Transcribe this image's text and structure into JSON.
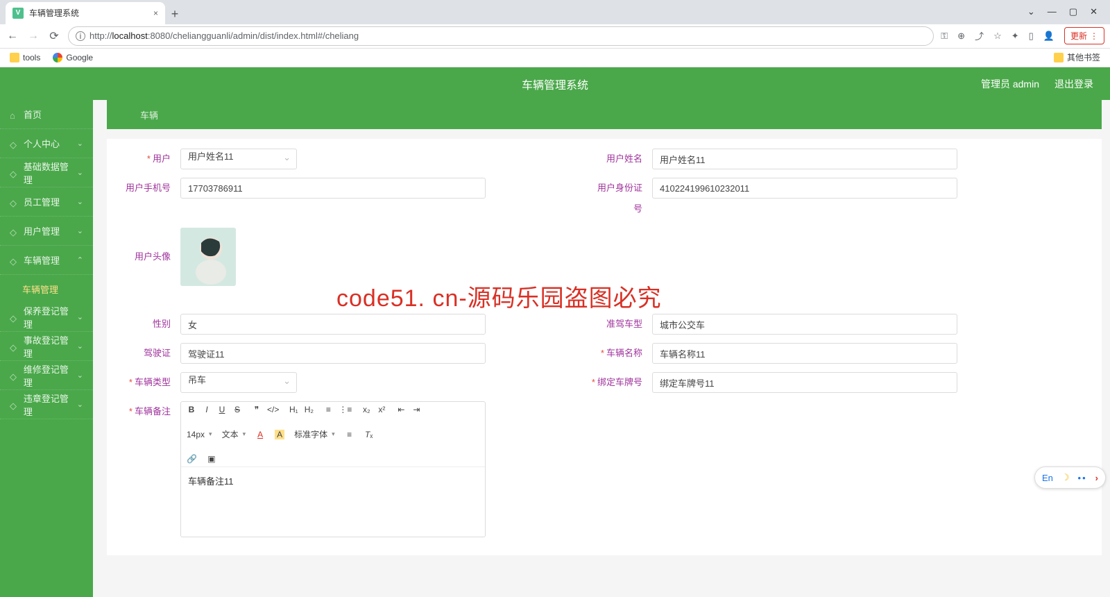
{
  "browser": {
    "tab_title": "车辆管理系统",
    "url_host": "localhost",
    "url_port": ":8080",
    "url_path": "/cheliangguanli/admin/dist/index.html#/cheliang",
    "url_prefix": "http://",
    "update_label": "更新",
    "bookmarks": {
      "tools": "tools",
      "google": "Google",
      "other": "其他书签"
    }
  },
  "header": {
    "title": "车辆管理系统",
    "admin": "管理员 admin",
    "logout": "退出登录"
  },
  "sidebar": {
    "items": [
      {
        "label": "首页",
        "chev": ""
      },
      {
        "label": "个人中心",
        "chev": "⌄"
      },
      {
        "label": "基础数据管理",
        "chev": "⌄"
      },
      {
        "label": "员工管理",
        "chev": "⌄"
      },
      {
        "label": "用户管理",
        "chev": "⌄"
      },
      {
        "label": "车辆管理",
        "chev": "⌃",
        "sub": "车辆管理"
      },
      {
        "label": "保养登记管理",
        "chev": "⌄"
      },
      {
        "label": "事故登记管理",
        "chev": "⌄"
      },
      {
        "label": "维修登记管理",
        "chev": "⌄"
      },
      {
        "label": "违章登记管理",
        "chev": "⌄"
      }
    ]
  },
  "breadcrumb": "车辆",
  "form": {
    "user_label": "用户",
    "user_value": "用户姓名11",
    "name_label": "用户姓名",
    "name_value": "用户姓名11",
    "phone_label": "用户手机号",
    "phone_value": "17703786911",
    "idno_label": "用户身份证号",
    "idno_value": "410224199610232011",
    "avatar_label": "用户头像",
    "gender_label": "性别",
    "gender_value": "女",
    "cartype_label": "准驾车型",
    "cartype_value": "城市公交车",
    "license_label": "驾驶证",
    "license_value": "驾驶证11",
    "carname_label": "车辆名称",
    "carname_value": "车辆名称11",
    "carkind_label": "车辆类型",
    "carkind_value": "吊车",
    "plate_label": "绑定车牌号",
    "plate_value": "绑定车牌号11",
    "remark_label": "车辆备注",
    "remark_value": "车辆备注11"
  },
  "editor_toolbar": {
    "fontsize": "14px",
    "fontfamily": "文本",
    "fontdefault": "标准字体"
  },
  "ime": {
    "lang": "En"
  },
  "watermark_big": "code51. cn-源码乐园盗图必究"
}
